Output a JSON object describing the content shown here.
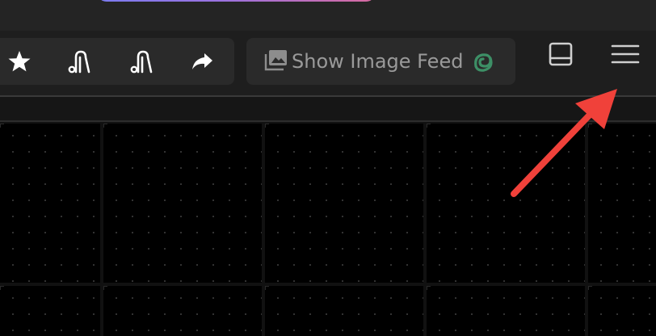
{
  "toolbar": {
    "actions": [
      {
        "icon": "star-icon"
      },
      {
        "icon": "vacuum-icon"
      },
      {
        "icon": "vacuum-icon"
      },
      {
        "icon": "share-arrow-icon"
      }
    ],
    "image_feed": {
      "label": "Show Image Feed",
      "icon": "image-icon",
      "logo_icon": "spiral-logo-icon"
    },
    "panel_toggle": {
      "icon": "panel-bottom-icon"
    },
    "menu": {
      "icon": "hamburger-menu-icon"
    }
  },
  "annotation": {
    "type": "arrow",
    "color": "#f0413a",
    "points_to": "menu-button"
  },
  "colors": {
    "background": "#202020",
    "button_bg": "#2a2a2a",
    "label_text": "#9a9a9a",
    "logo_green": "#3d8f66",
    "grid_bg": "#000000"
  }
}
